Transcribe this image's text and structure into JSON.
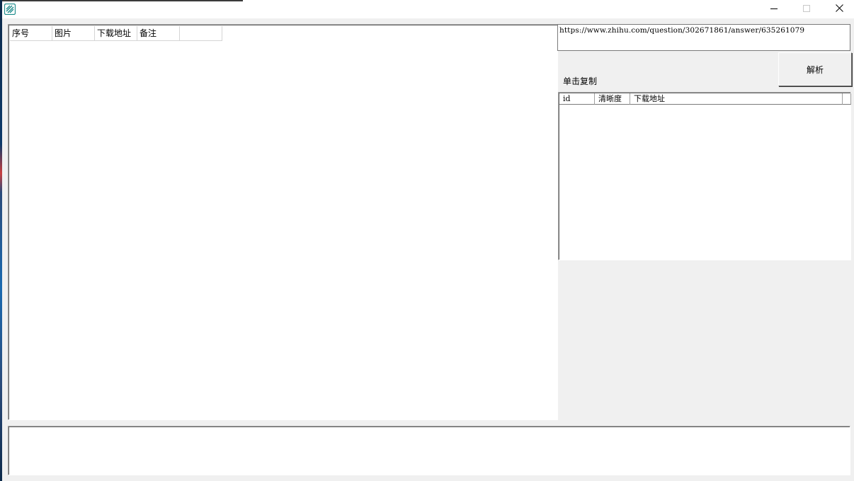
{
  "window": {
    "title": "",
    "controls": {
      "minimize_icon": "minimize-icon",
      "maximize_icon": "maximize-icon",
      "close_icon": "close-icon"
    }
  },
  "main_list": {
    "columns": [
      "序号",
      "图片",
      "下载地址",
      "备注",
      ""
    ]
  },
  "url_input": {
    "value": "https://www.zhihu.com/question/302671861/answer/635261079"
  },
  "parse_button": {
    "label": "解析"
  },
  "copy_hint": "单击复制",
  "side_list": {
    "columns": [
      "id",
      "清晰度",
      "下载地址",
      ""
    ]
  },
  "log_box": {
    "value": ""
  },
  "colors": {
    "accent_icon": "#1a8a8a",
    "border_dark": "#696969",
    "window_bg": "#f0f0f0"
  }
}
